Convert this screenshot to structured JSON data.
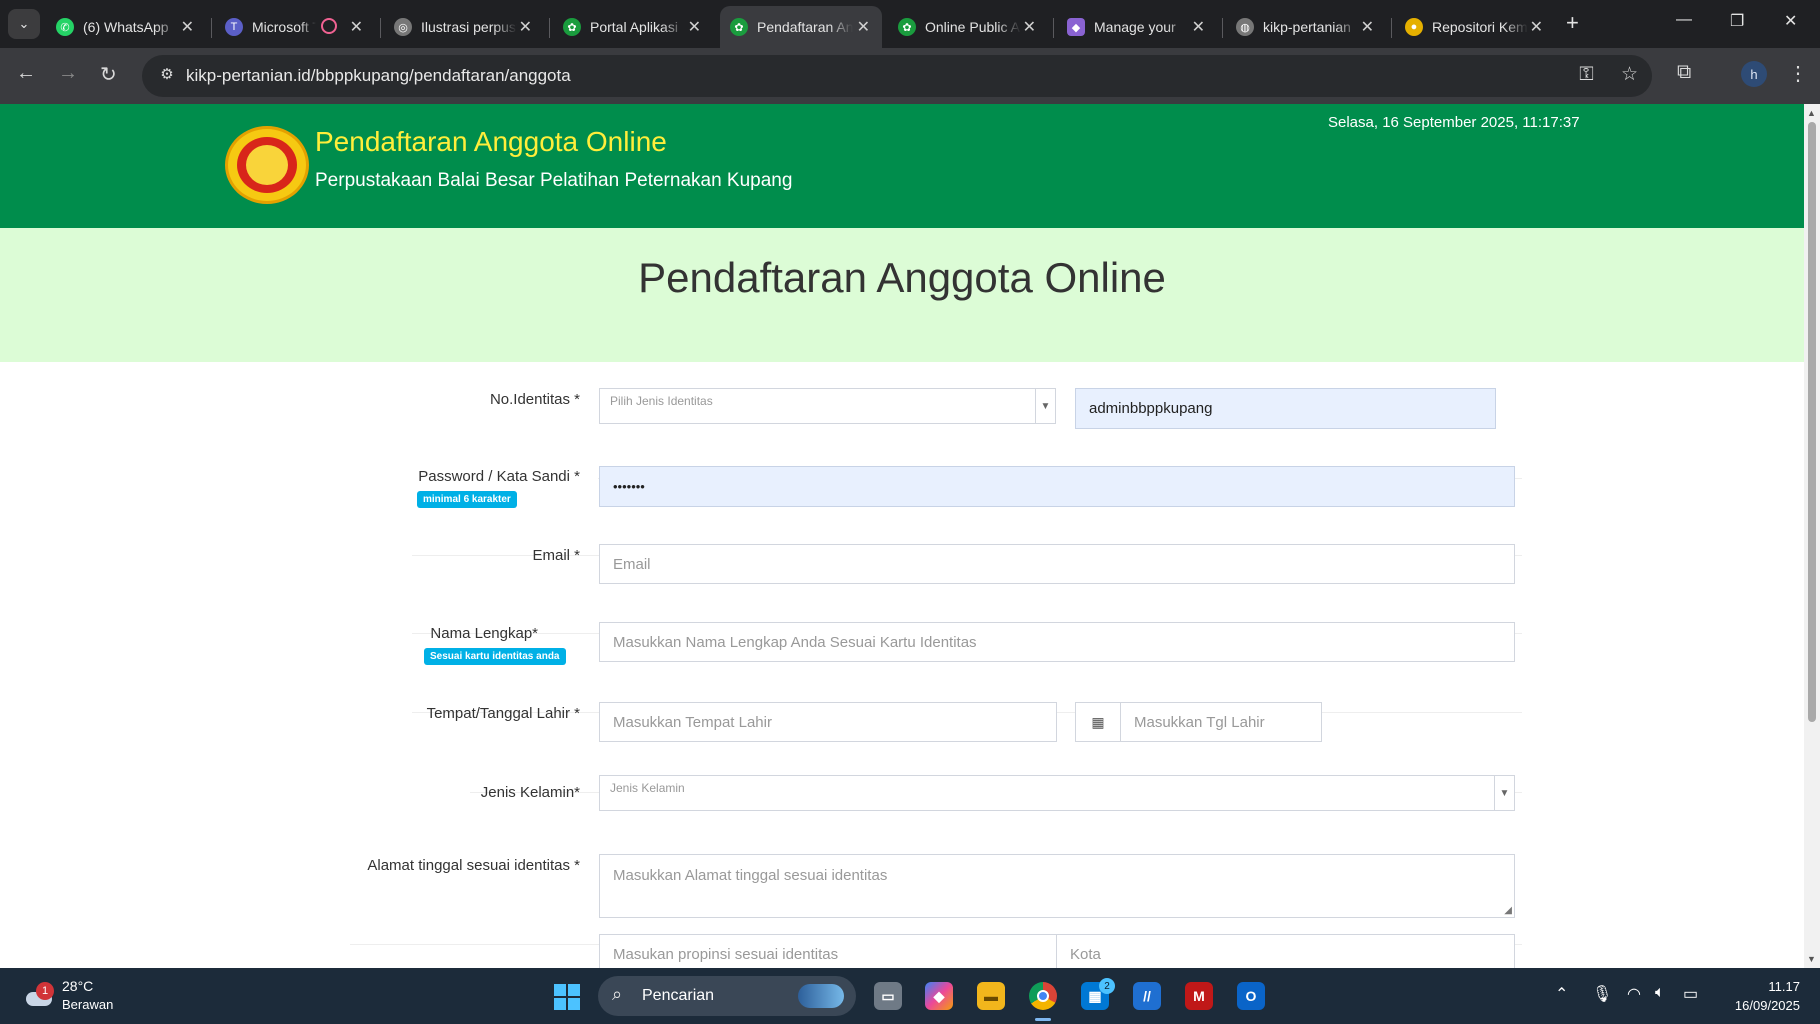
{
  "browser": {
    "tabs": [
      {
        "label": "(6) WhatsApp",
        "color": "#25d366",
        "glyph": "✆"
      },
      {
        "label": "Microsoft Teams",
        "color": "#5b5fc7",
        "glyph": "T"
      },
      {
        "label": "Ilustrasi perpustakaan",
        "color": "#777777",
        "glyph": "◎"
      },
      {
        "label": "Portal Aplikasi",
        "color": "#1a9c3e",
        "glyph": "✿"
      },
      {
        "label": "Pendaftaran Anggota",
        "color": "#1a9c3e",
        "glyph": "✿"
      },
      {
        "label": "Online Public Access",
        "color": "#1a9c3e",
        "glyph": "✿"
      },
      {
        "label": "Manage your",
        "color": "#8a63d2",
        "glyph": "◆"
      },
      {
        "label": "kikp-pertanian",
        "color": "#777777",
        "glyph": "◍"
      },
      {
        "label": "Repositori Kementan",
        "color": "#e5b000",
        "glyph": "●"
      }
    ],
    "url": "kikp-pertanian.id/bbppkupang/pendaftaran/anggota",
    "profile_initial": "h"
  },
  "header": {
    "title": "Pendaftaran Anggota Online",
    "subtitle": "Perpustakaan Balai Besar Pelatihan Peternakan Kupang",
    "datetime": "Selasa, 16 September 2025, 11:17:37"
  },
  "hero": {
    "title": "Pendaftaran Anggota Online"
  },
  "form": {
    "identity": {
      "label": "No.Identitas *",
      "type_placeholder": "Pilih Jenis Identitas",
      "value": "adminbbppkupang"
    },
    "password": {
      "label": "Password / Kata Sandi *",
      "hint": "minimal 6 karakter",
      "value": "•••••••"
    },
    "email": {
      "label": "Email *",
      "placeholder": "Email"
    },
    "fullname": {
      "label": "Nama Lengkap*",
      "hint": "Sesuai kartu identitas anda",
      "placeholder": "Masukkan Nama Lengkap Anda Sesuai Kartu Identitas"
    },
    "birth": {
      "label": "Tempat/Tanggal Lahir *",
      "place_placeholder": "Masukkan Tempat Lahir",
      "date_placeholder": "Masukkan Tgl Lahir"
    },
    "gender": {
      "label": "Jenis Kelamin*",
      "placeholder": "Jenis Kelamin"
    },
    "address": {
      "label": "Alamat tinggal sesuai identitas *",
      "placeholder": "Masukkan Alamat tinggal sesuai identitas",
      "province_placeholder": "Masukan propinsi sesuai identitas",
      "city_placeholder": "Kota"
    }
  },
  "taskbar": {
    "weather_temp": "28°C",
    "weather_desc": "Berawan",
    "weather_alert": "1",
    "search_label": "Pencarian",
    "store_badge": "2",
    "time": "11.17",
    "date": "16/09/2025"
  }
}
